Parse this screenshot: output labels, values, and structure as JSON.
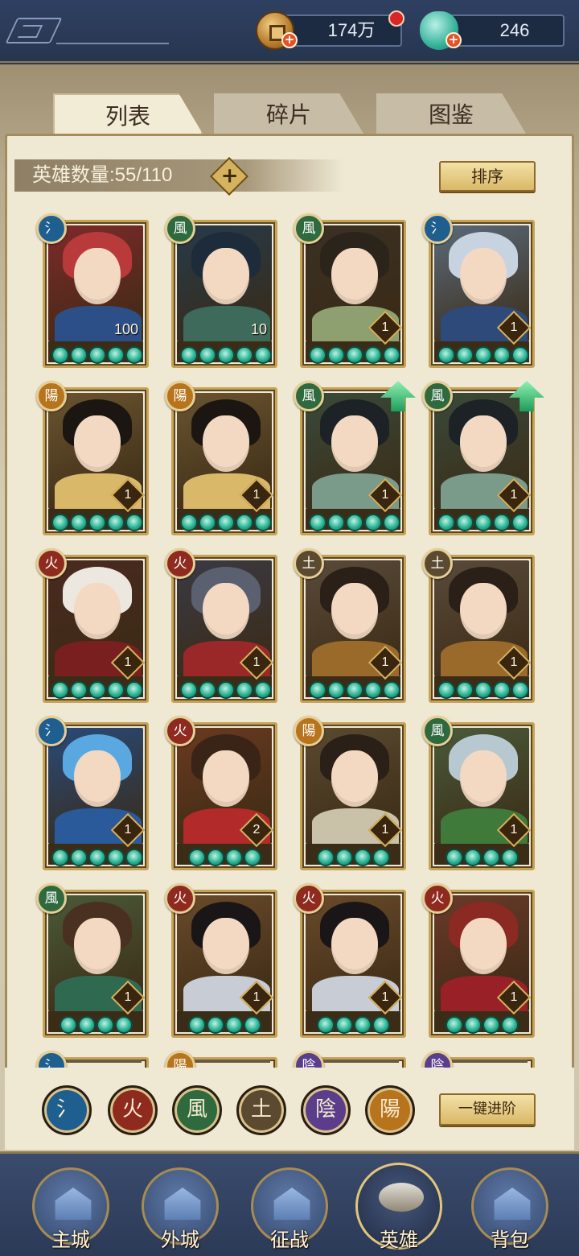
{
  "resources": {
    "coins": "174万",
    "jade": "246"
  },
  "tabs": [
    {
      "label": "列表",
      "active": true
    },
    {
      "label": "碎片",
      "active": false
    },
    {
      "label": "图鉴",
      "active": false
    }
  ],
  "hero_count": {
    "label": "英雄数量:",
    "value": "55/110",
    "add_glyph": "+"
  },
  "sort_label": "排序",
  "advance_label": "一键进阶",
  "element_glyphs": {
    "water": "氵",
    "fire": "火",
    "wind": "風",
    "earth": "土",
    "yin": "陰",
    "yang": "陽"
  },
  "element_colors": {
    "water": "#1f5f8f",
    "fire": "#8f2a1f",
    "wind": "#2f6a3f",
    "earth": "#5c4a30",
    "yin": "#5a3e8c",
    "yang": "#b8741c"
  },
  "heroes": [
    {
      "element": "water",
      "level": "100",
      "stars": 5,
      "upgrade": false
    },
    {
      "element": "wind",
      "level": "10",
      "stars": 5,
      "upgrade": false
    },
    {
      "element": "wind",
      "level": "1",
      "stars": 5,
      "upgrade": false
    },
    {
      "element": "water",
      "level": "1",
      "stars": 5,
      "upgrade": false
    },
    {
      "element": "yang",
      "level": "1",
      "stars": 5,
      "upgrade": false
    },
    {
      "element": "yang",
      "level": "1",
      "stars": 5,
      "upgrade": false
    },
    {
      "element": "wind",
      "level": "1",
      "stars": 5,
      "upgrade": true
    },
    {
      "element": "wind",
      "level": "1",
      "stars": 5,
      "upgrade": true
    },
    {
      "element": "fire",
      "level": "1",
      "stars": 5,
      "upgrade": false
    },
    {
      "element": "fire",
      "level": "1",
      "stars": 5,
      "upgrade": false
    },
    {
      "element": "earth",
      "level": "1",
      "stars": 5,
      "upgrade": false
    },
    {
      "element": "earth",
      "level": "1",
      "stars": 5,
      "upgrade": false
    },
    {
      "element": "water",
      "level": "1",
      "stars": 5,
      "upgrade": false
    },
    {
      "element": "fire",
      "level": "2",
      "stars": 4,
      "upgrade": false
    },
    {
      "element": "yang",
      "level": "1",
      "stars": 4,
      "upgrade": false
    },
    {
      "element": "wind",
      "level": "1",
      "stars": 4,
      "upgrade": false
    },
    {
      "element": "wind",
      "level": "1",
      "stars": 4,
      "upgrade": false
    },
    {
      "element": "fire",
      "level": "1",
      "stars": 4,
      "upgrade": false
    },
    {
      "element": "fire",
      "level": "1",
      "stars": 4,
      "upgrade": false
    },
    {
      "element": "fire",
      "level": "1",
      "stars": 4,
      "upgrade": false
    },
    {
      "element": "water",
      "level": "",
      "stars": 0,
      "upgrade": false
    },
    {
      "element": "yang",
      "level": "",
      "stars": 0,
      "upgrade": false
    },
    {
      "element": "yin",
      "level": "",
      "stars": 0,
      "upgrade": false
    },
    {
      "element": "yin",
      "level": "",
      "stars": 0,
      "upgrade": false
    }
  ],
  "filters": [
    "water",
    "fire",
    "wind",
    "earth",
    "yin",
    "yang"
  ],
  "nav": [
    {
      "label": "主城",
      "icon": "main-city-icon",
      "active": false
    },
    {
      "label": "外城",
      "icon": "outer-city-icon",
      "active": false
    },
    {
      "label": "征战",
      "icon": "campaign-icon",
      "active": false
    },
    {
      "label": "英雄",
      "icon": "hero-icon",
      "active": true
    },
    {
      "label": "背包",
      "icon": "backpack-icon",
      "active": false
    }
  ]
}
